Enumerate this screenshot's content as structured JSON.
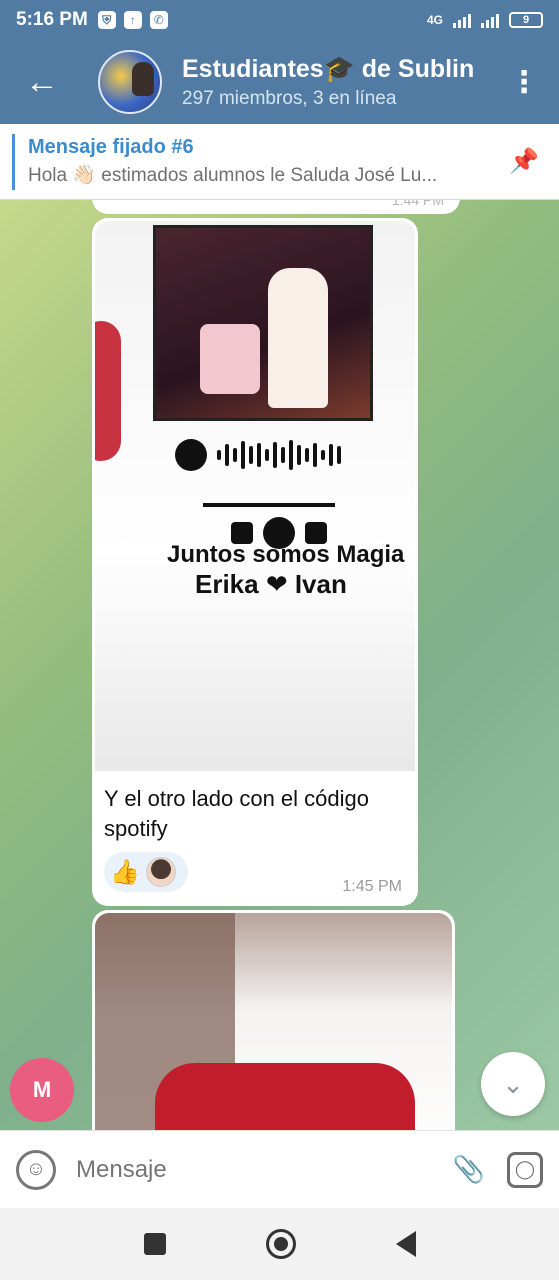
{
  "status": {
    "time": "5:16 PM",
    "network": "4G",
    "battery": "9"
  },
  "header": {
    "title": "Estudiantes🎓 de Sublin",
    "subtitle": "297 miembros, 3 en línea"
  },
  "pinned": {
    "title": "Mensaje fijado #6",
    "text": "Hola 👋🏻 estimados alumnos le Saluda José Lu..."
  },
  "message": {
    "image_text_line1": "Juntos somos Magia",
    "image_text_line2": "Erika ❤ Ivan",
    "caption": "Y el otro lado con el código spotify",
    "reaction_emoji": "👍",
    "time": "1:45 PM"
  },
  "prev_message": {
    "time_partial": "1:44 PM"
  },
  "avatar_letter": "M",
  "input": {
    "placeholder": "Mensaje"
  },
  "icons": {
    "back": "arrow-left",
    "menu": "more-vertical",
    "pin": "pinned-list",
    "emoji": "smile",
    "attach": "paperclip",
    "camera": "instagram-camera",
    "scroll_down": "chevron-down"
  }
}
